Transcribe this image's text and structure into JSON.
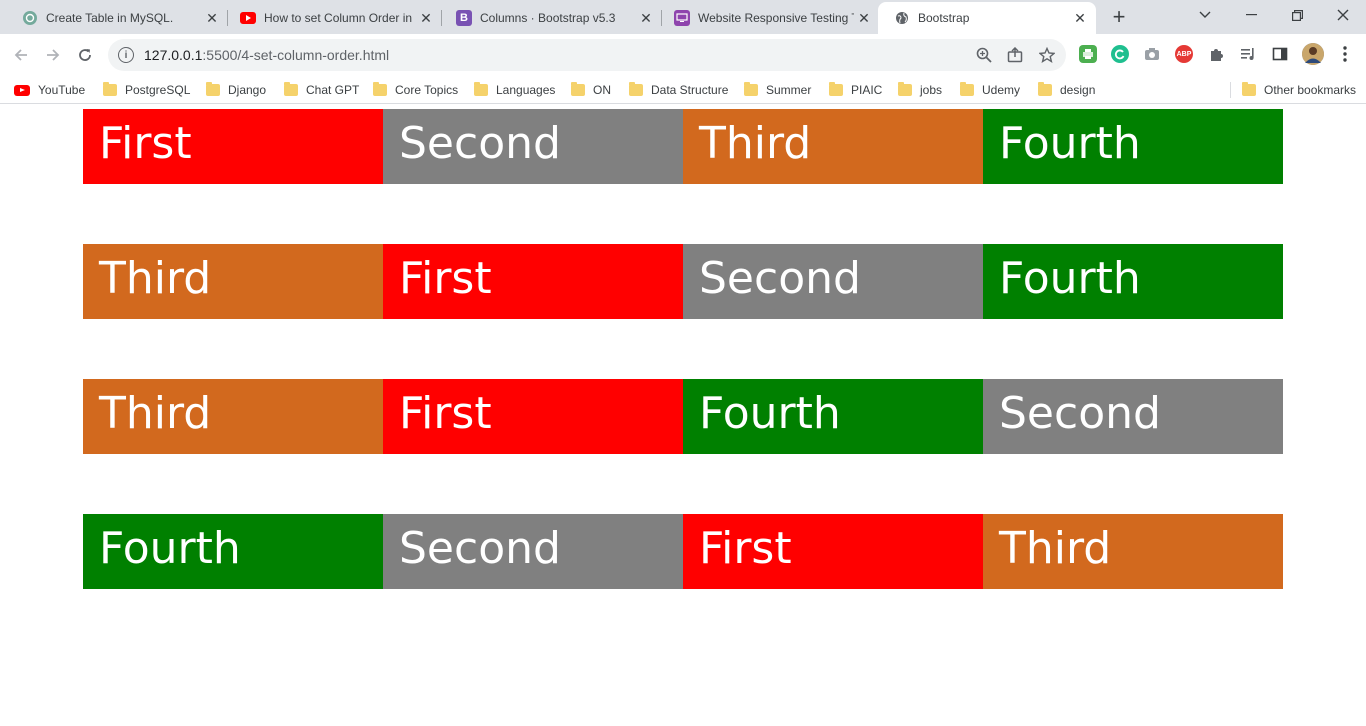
{
  "tabs": [
    {
      "title": "Create Table in MySQL.",
      "icon": "chatgpt-icon"
    },
    {
      "title": "How to set Column Order in B",
      "icon": "youtube-icon"
    },
    {
      "title": "Columns · Bootstrap v5.3",
      "icon": "bootstrap-icon"
    },
    {
      "title": "Website Responsive Testing T",
      "icon": "responsive-test-icon"
    },
    {
      "title": "Bootstrap",
      "icon": "globe-icon",
      "active": true
    }
  ],
  "address_bar": {
    "host": "127.0.0.1",
    "path": ":5500/4-set-column-order.html"
  },
  "bookmarks": [
    {
      "label": "YouTube",
      "icon": "youtube-icon"
    },
    {
      "label": "PostgreSQL",
      "icon": "folder-icon"
    },
    {
      "label": "Django",
      "icon": "folder-icon"
    },
    {
      "label": "Chat GPT",
      "icon": "folder-icon"
    },
    {
      "label": "Core Topics",
      "icon": "folder-icon"
    },
    {
      "label": "Languages",
      "icon": "folder-icon"
    },
    {
      "label": "ON",
      "icon": "folder-icon"
    },
    {
      "label": "Data Structure",
      "icon": "folder-icon"
    },
    {
      "label": "Summer",
      "icon": "folder-icon"
    },
    {
      "label": "PIAIC",
      "icon": "folder-icon"
    },
    {
      "label": "jobs",
      "icon": "folder-icon"
    },
    {
      "label": "Udemy",
      "icon": "folder-icon"
    },
    {
      "label": "design",
      "icon": "folder-icon"
    }
  ],
  "other_bookmarks": "Other bookmarks",
  "extensions": {
    "abp_label": "ABP"
  },
  "colors": {
    "First": "#ff0000",
    "Second": "#808080",
    "Third": "#d2691e",
    "Fourth": "#008000"
  },
  "rows": [
    {
      "cells": [
        "First",
        "Second",
        "Third",
        "Fourth"
      ]
    },
    {
      "cells": [
        "Third",
        "First",
        "Second",
        "Fourth"
      ]
    },
    {
      "cells": [
        "Third",
        "First",
        "Fourth",
        "Second"
      ]
    },
    {
      "cells": [
        "Fourth",
        "Second",
        "First",
        "Third"
      ]
    }
  ]
}
